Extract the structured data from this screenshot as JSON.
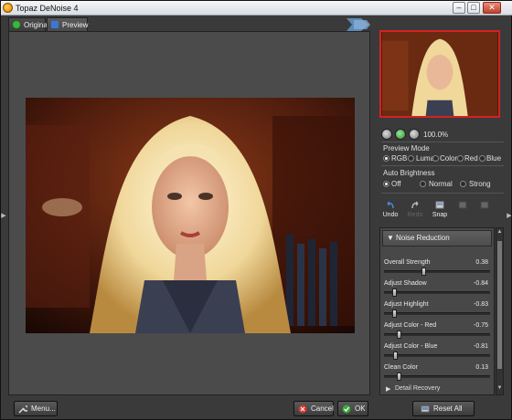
{
  "app": {
    "title": "Topaz DeNoise 4"
  },
  "window_buttons": {
    "minimize": "–",
    "maximize": "□",
    "close": "✕"
  },
  "tabs": [
    {
      "label": "Original",
      "color": "#2fbf2f"
    },
    {
      "label": "Preview",
      "color": "#3a78d8"
    }
  ],
  "navigator": {
    "zoom": "100.0%"
  },
  "preview_mode": {
    "title": "Preview Mode",
    "options": [
      "RGB",
      "Luma",
      "Color",
      "Red",
      "Blue"
    ],
    "selected": "RGB"
  },
  "auto_brightness": {
    "title": "Auto Brightness",
    "options": [
      "Off",
      "Normal",
      "Strong"
    ],
    "selected": "Off"
  },
  "toolbar": {
    "undo": "Undo",
    "redo": "Redo",
    "snap": "Snap"
  },
  "noise_reduction": {
    "title": "Noise Reduction",
    "sliders": [
      {
        "label": "Overall Strength",
        "value": "0.38",
        "fraction": 0.38
      },
      {
        "label": "Adjust Shadow",
        "value": "-0.84",
        "fraction": 0.08
      },
      {
        "label": "Adjust Highlight",
        "value": "-0.83",
        "fraction": 0.085
      },
      {
        "label": "Adjust Color - Red",
        "value": "-0.75",
        "fraction": 0.125
      },
      {
        "label": "Adjust Color - Blue",
        "value": "-0.81",
        "fraction": 0.095
      },
      {
        "label": "Clean Color",
        "value": "0.13",
        "fraction": 0.13
      }
    ],
    "next_section": "Detail Recovery"
  },
  "buttons": {
    "menu": "Menu...",
    "cancel": "Cancel",
    "ok": "OK",
    "reset_all": "Reset All"
  },
  "colors": {
    "accent_red": "#d42222",
    "panel": "#3a3a3a",
    "canvas": "#4b4b4b"
  }
}
